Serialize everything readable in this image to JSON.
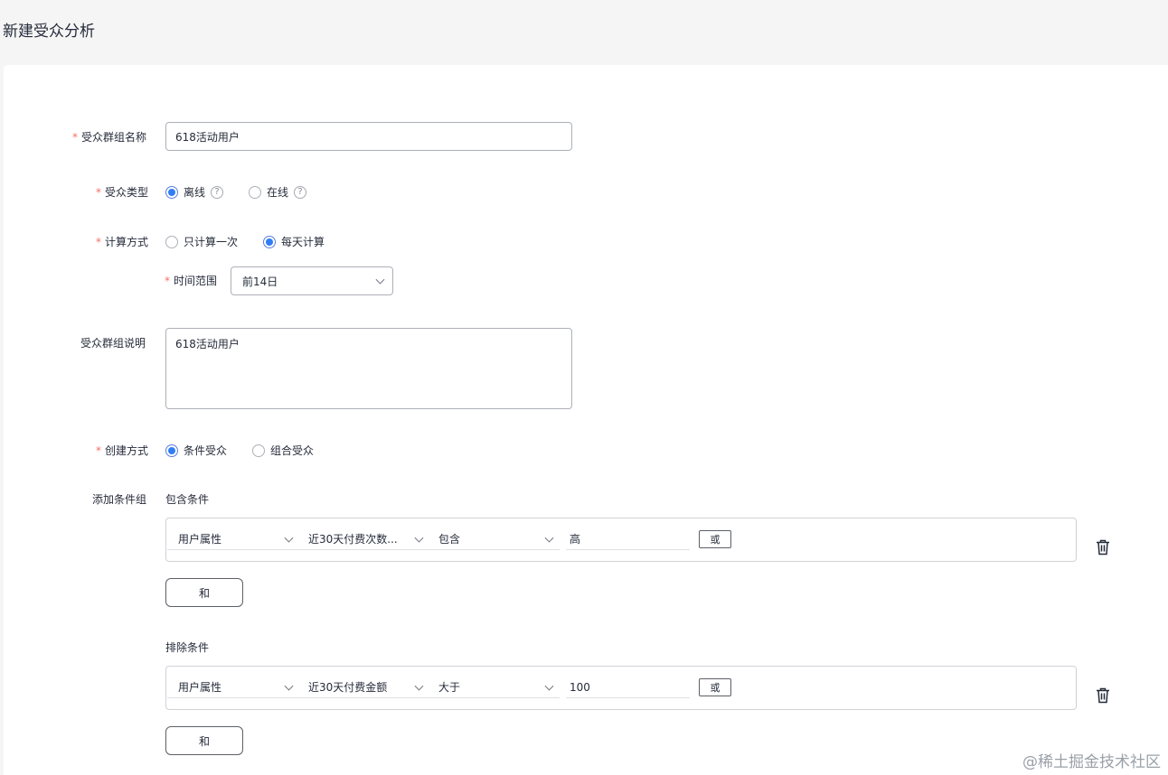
{
  "page": {
    "title": "新建受众分析"
  },
  "form": {
    "name": {
      "label": "受众群组名称",
      "value": "618活动用户"
    },
    "type": {
      "label": "受众类型",
      "options": [
        {
          "label": "离线",
          "checked": true
        },
        {
          "label": "在线",
          "checked": false
        }
      ],
      "help": "?"
    },
    "calc": {
      "label": "计算方式",
      "options": [
        {
          "label": "只计算一次",
          "checked": false
        },
        {
          "label": "每天计算",
          "checked": true
        }
      ]
    },
    "range": {
      "label": "时间范围",
      "value": "前14日"
    },
    "desc": {
      "label": "受众群组说明",
      "value": "618活动用户"
    },
    "create": {
      "label": "创建方式",
      "options": [
        {
          "label": "条件受众",
          "checked": true
        },
        {
          "label": "组合受众",
          "checked": false
        }
      ]
    },
    "groups_label": "添加条件组",
    "include": {
      "title": "包含条件",
      "attr": "用户属性",
      "field": "近30天付费次数...",
      "op": "包含",
      "value": "高",
      "or_label": "或",
      "and_label": "和"
    },
    "exclude": {
      "title": "排除条件",
      "attr": "用户属性",
      "field": "近30天付费金额",
      "op": "大于",
      "value": "100",
      "or_label": "或",
      "and_label": "和"
    }
  },
  "required_mark": "*",
  "watermark": "@稀土掘金技术社区",
  "colors": {
    "accent": "#2f7ef5",
    "required": "#f66f6a"
  }
}
